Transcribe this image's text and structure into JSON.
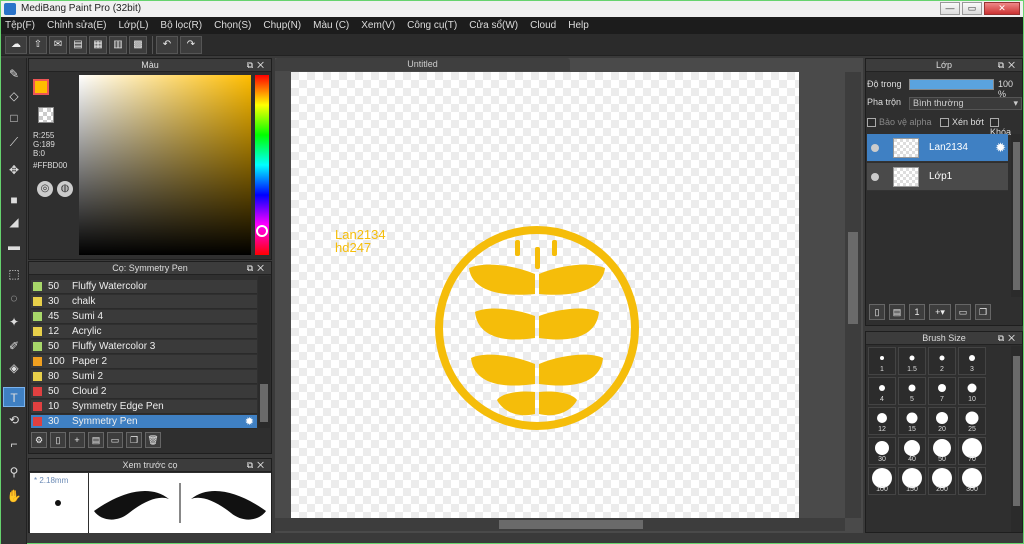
{
  "window": {
    "title": "MediBang Paint Pro (32bit)",
    "min": "—",
    "max": "▭",
    "close": "✕"
  },
  "menu": [
    "Tệp(F)",
    "Chỉnh sửa(E)",
    "Lớp(L)",
    "Bộ lọc(R)",
    "Chọn(S)",
    "Chụp(N)",
    "Màu (C)",
    "Xem(V)",
    "Công cụ(T)",
    "Cửa sổ(W)",
    "Cloud",
    "Help"
  ],
  "color_panel": {
    "title": "Màu",
    "r": "R:255",
    "g": "G:189",
    "b": "B:0",
    "hex": "#FFBD00",
    "primary_color": "#ffbd00"
  },
  "brush_panel": {
    "title": "Cọ: Symmetry Pen",
    "brushes": [
      {
        "size": "50",
        "name": "Fluffy Watercolor",
        "color": "#a8d86a"
      },
      {
        "size": "30",
        "name": "chalk",
        "color": "#e8d04a"
      },
      {
        "size": "45",
        "name": "Sumi 4",
        "color": "#a8d86a"
      },
      {
        "size": "12",
        "name": "Acrylic",
        "color": "#e8d04a"
      },
      {
        "size": "50",
        "name": "Fluffy Watercolor 3",
        "color": "#a8d86a"
      },
      {
        "size": "100",
        "name": "Paper 2",
        "color": "#f0a020"
      },
      {
        "size": "80",
        "name": "Sumi 2",
        "color": "#e8d04a"
      },
      {
        "size": "50",
        "name": "Cloud 2",
        "color": "#e04040"
      },
      {
        "size": "10",
        "name": "Symmetry Edge Pen",
        "color": "#e04040"
      },
      {
        "size": "30",
        "name": "Symmetry Pen",
        "color": "#e04040"
      }
    ]
  },
  "preview_panel": {
    "title": "Xem trước cọ",
    "size": "* 2.18mm"
  },
  "canvas": {
    "tab": "Untitled",
    "watermark_line1": "Lan2134",
    "watermark_line2": "hd247",
    "logo_color": "#f5bd0a"
  },
  "layers_panel": {
    "title": "Lớp",
    "opacity_label": "Độ trong",
    "opacity_value": "100 %",
    "opacity": 1.0,
    "blend_label": "Pha trộn",
    "blend_value": "Bình thường",
    "protect_alpha": "Bảo vệ alpha",
    "clipping": "Xén bớt",
    "lock": "Khóa",
    "layers": [
      {
        "name": "Lan2134",
        "selected": true
      },
      {
        "name": "Lớp1",
        "selected": false
      }
    ]
  },
  "brush_size_panel": {
    "title": "Brush Size",
    "sizes": [
      "1",
      "1.5",
      "2",
      "3",
      "4",
      "5",
      "7",
      "10",
      "12",
      "15",
      "20",
      "25",
      "30",
      "40",
      "50",
      "70",
      "100",
      "150",
      "200",
      "300"
    ]
  }
}
